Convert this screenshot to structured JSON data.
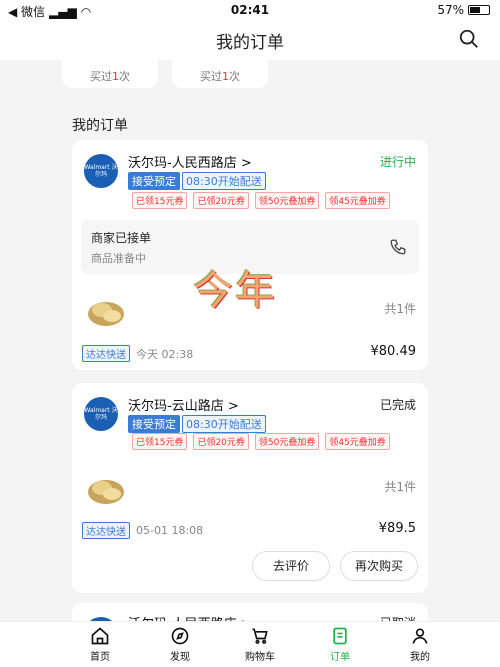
{
  "status_bar": {
    "carrier": "◀ 微信",
    "time": "02:41",
    "battery": "57%",
    "battery_level": 0.57
  },
  "nav": {
    "title": "我的订单"
  },
  "peek": [
    {
      "prefix": "买过",
      "num": "1",
      "suffix": "次"
    },
    {
      "prefix": "买过",
      "num": "1",
      "suffix": "次"
    }
  ],
  "section_title": "我的订单",
  "orders": [
    {
      "store": "沃尔玛-人民西路店 >",
      "status": "进行中",
      "status_color": "#22b14c",
      "tag1": "接受预定",
      "tag2": "08:30开始配送",
      "coupons": [
        "已领15元券",
        "已领20元券",
        "领50元叠加券",
        "领45元叠加券"
      ],
      "notice_title": "商家已接单",
      "notice_sub": "商品准备中",
      "count": "共1件",
      "delivery_badge": "达达快送",
      "delivery_time": "今天 02:38",
      "price": "¥80.49"
    },
    {
      "store": "沃尔玛-云山路店 >",
      "status": "已完成",
      "status_color": "#222222",
      "tag1": "接受预定",
      "tag2": "08:30开始配送",
      "coupons": [
        "已领15元券",
        "已领20元券",
        "领50元叠加券",
        "领45元叠加券"
      ],
      "count": "共1件",
      "delivery_badge": "达达快送",
      "delivery_time": "05-01 18:08",
      "price": "¥89.5",
      "btn_review": "去评价",
      "btn_rebuy": "再次购买"
    },
    {
      "store": "沃尔玛-人民西路店 >",
      "status": "已取消"
    }
  ],
  "logo_text": "Walmart 沃尔玛",
  "overlay_text": "今年",
  "tabs": [
    {
      "label": "首页",
      "icon": "home-icon"
    },
    {
      "label": "发现",
      "icon": "compass-icon"
    },
    {
      "label": "购物车",
      "icon": "cart-icon"
    },
    {
      "label": "订单",
      "icon": "order-icon",
      "active": true
    },
    {
      "label": "我的",
      "icon": "profile-icon"
    }
  ]
}
